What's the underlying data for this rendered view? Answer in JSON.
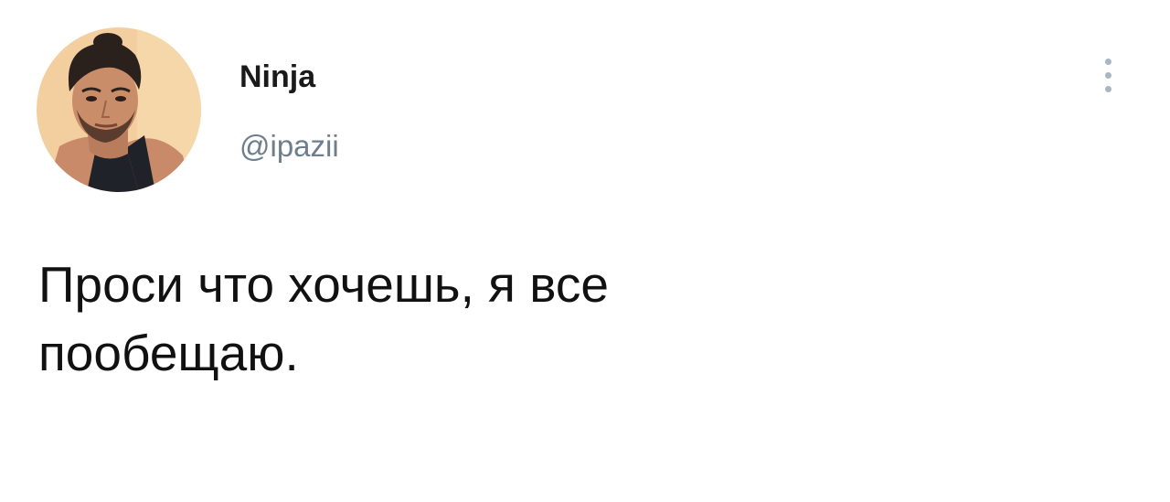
{
  "tweet": {
    "author": {
      "display_name": "Ninja",
      "handle": "@ipazii",
      "avatar_icon": "user-avatar-photo"
    },
    "menu_icon": "more-vertical-icon",
    "text": "Проси что хочешь, я все\nпообещаю."
  },
  "colors": {
    "background": "#ffffff",
    "name": "#1a1a1a",
    "handle": "#6f7e8c",
    "menu_dots": "#a9b6c1",
    "text": "#111111"
  }
}
